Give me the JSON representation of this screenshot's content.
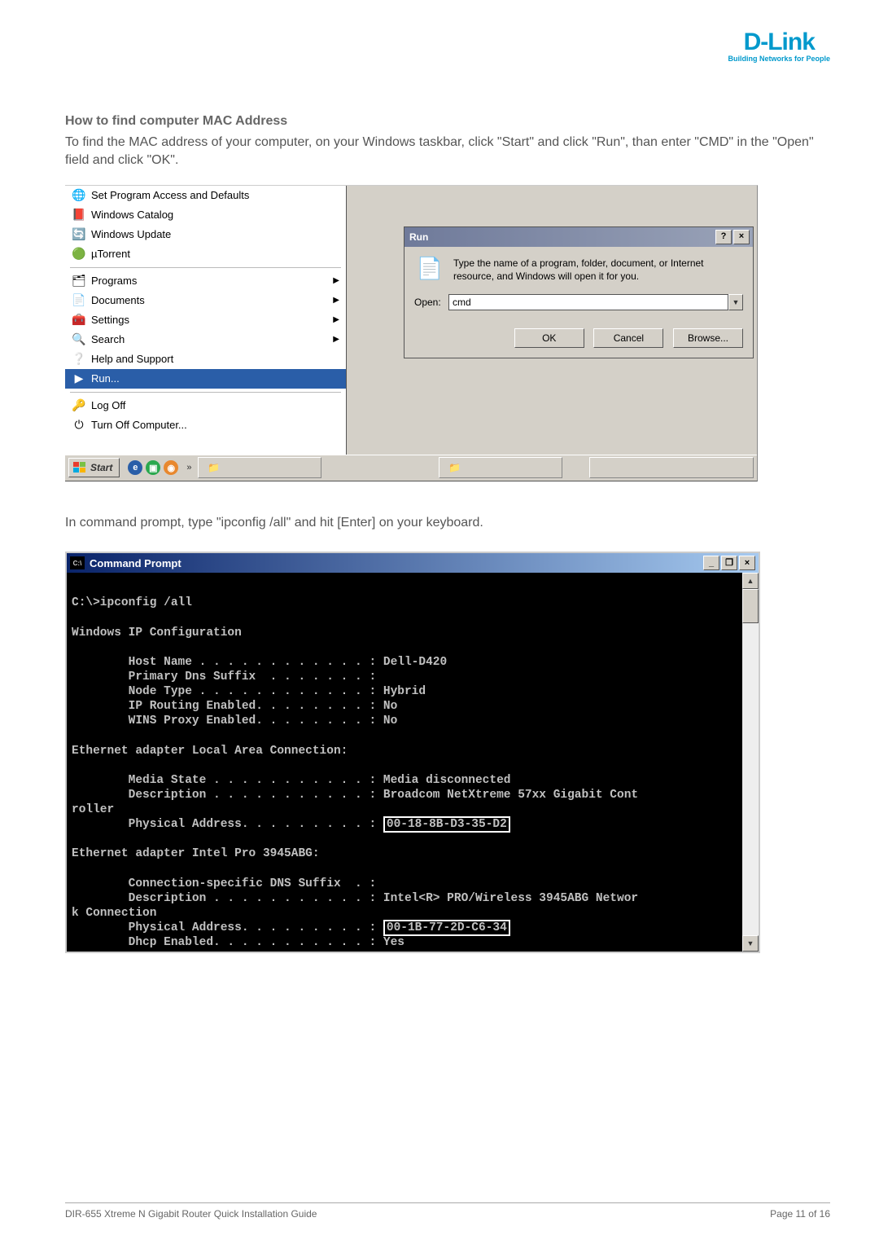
{
  "logo": {
    "brand": "D-Link",
    "tagline": "Building Networks for People"
  },
  "section_title": "How to find computer MAC Address",
  "intro_text": "To find the MAC address of your computer, on your Windows taskbar, click \"Start\" and click \"Run\", than enter \"CMD\" in the \"Open\" field and click \"OK\".",
  "start_menu": {
    "items_top": [
      {
        "icon": "🌐",
        "label": "Set Program Access and Defaults"
      },
      {
        "icon": "📕",
        "label": "Windows Catalog"
      },
      {
        "icon": "🔄",
        "label": "Windows Update"
      },
      {
        "icon": "🟢",
        "label": "µTorrent"
      }
    ],
    "items_mid": [
      {
        "icon": "🗂",
        "label": "Programs",
        "sub": true
      },
      {
        "icon": "📄",
        "label": "Documents",
        "sub": true
      },
      {
        "icon": "🧰",
        "label": "Settings",
        "sub": true
      },
      {
        "icon": "🔍",
        "label": "Search",
        "sub": true
      },
      {
        "icon": "❔",
        "label": "Help and Support"
      },
      {
        "icon": "▶",
        "label": "Run...",
        "selected": true
      }
    ],
    "items_bot": [
      {
        "icon": "🔑",
        "label": "Log Off"
      },
      {
        "icon": "⏻",
        "label": "Turn Off Computer..."
      }
    ]
  },
  "run_dialog": {
    "title": "Run",
    "help_btn": "?",
    "close_btn": "×",
    "description": "Type the name of a program, folder, document, or Internet resource, and Windows will open it for you.",
    "open_label": "Open:",
    "open_value": "cmd",
    "ok": "OK",
    "cancel": "Cancel",
    "browse": "Browse..."
  },
  "taskbar": {
    "start_label": "Start",
    "chevron": "»",
    "task1_icon": "📁",
    "task1_label": "",
    "task2_icon": "📁",
    "task2_label": "",
    "task3_icon": "",
    "task3_label": ""
  },
  "mid_text": "In command prompt, type \"ipconfig /all\" and hit [Enter] on your keyboard.",
  "cmd": {
    "title": "Command Prompt",
    "min": "_",
    "max": "❐",
    "close": "×",
    "lines": {
      "l0": "",
      "l1": "C:\\>ipconfig /all",
      "l2": "",
      "l3": "Windows IP Configuration",
      "l4": "",
      "l5": "        Host Name . . . . . . . . . . . . : Dell-D420",
      "l6": "        Primary Dns Suffix  . . . . . . . :",
      "l7": "        Node Type . . . . . . . . . . . . : Hybrid",
      "l8": "        IP Routing Enabled. . . . . . . . : No",
      "l9": "        WINS Proxy Enabled. . . . . . . . : No",
      "l10": "",
      "l11": "Ethernet adapter Local Area Connection:",
      "l12": "",
      "l13": "        Media State . . . . . . . . . . . : Media disconnected",
      "l14": "        Description . . . . . . . . . . . : Broadcom NetXtreme 57xx Gigabit Cont",
      "l15": "roller",
      "l16a": "        Physical Address. . . . . . . . . : ",
      "l16b": "00-18-8B-D3-35-D2",
      "l17": "",
      "l18": "Ethernet adapter Intel Pro 3945ABG:",
      "l19": "",
      "l20": "        Connection-specific DNS Suffix  . :",
      "l21": "        Description . . . . . . . . . . . : Intel<R> PRO/Wireless 3945ABG Networ",
      "l22": "k Connection",
      "l23a": "        Physical Address. . . . . . . . . : ",
      "l23b": "00-1B-77-2D-C6-34",
      "l24": "        Dhcp Enabled. . . . . . . . . . . : Yes"
    }
  },
  "footer": {
    "left": "DIR-655 Xtreme N Gigabit Router Quick Installation Guide",
    "right": "Page 11 of 16"
  }
}
